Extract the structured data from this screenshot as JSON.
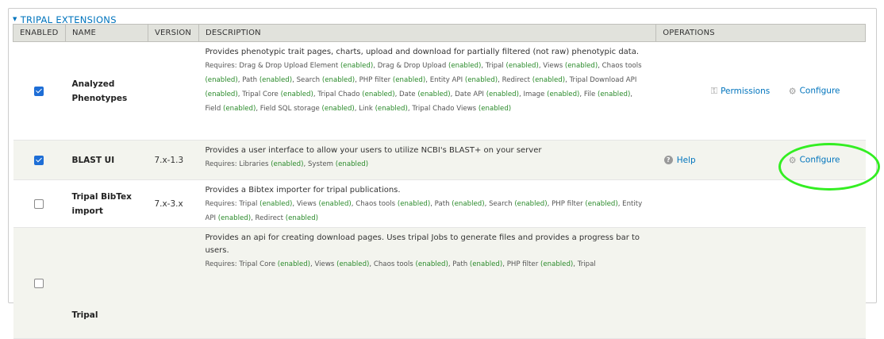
{
  "section": {
    "title": "TRIPAL EXTENSIONS"
  },
  "columns": {
    "enabled": "ENABLED",
    "name": "NAME",
    "version": "VERSION",
    "description": "DESCRIPTION",
    "operations": "OPERATIONS"
  },
  "modules": [
    {
      "enabled": true,
      "name": "Analyzed Phenotypes",
      "version": "",
      "description": "Provides phenotypic trait pages, charts, upload and download for partially filtered (not raw) phenotypic data.",
      "requires_label": "Requires:",
      "enabled_tag": "(enabled)",
      "requires": [
        "Drag & Drop Upload Element",
        "Drag & Drop Upload",
        "Tripal",
        "Views",
        "Chaos tools",
        "Path",
        "Search",
        "PHP filter",
        "Entity API",
        "Redirect",
        "Tripal Download API",
        "Tripal Core",
        "Tripal Chado",
        "Date",
        "Date API",
        "Image",
        "File",
        "Field",
        "Field SQL storage",
        "Link",
        "Tripal Chado Views"
      ],
      "operations": {
        "permissions": "Permissions",
        "configure": "Configure"
      }
    },
    {
      "enabled": true,
      "name": "BLAST UI",
      "version": "7.x-1.3",
      "description": "Provides a user interface to allow your users to utilize NCBI's BLAST+ on your server",
      "requires_label": "Requires:",
      "enabled_tag": "(enabled)",
      "requires": [
        "Libraries",
        "System"
      ],
      "operations": {
        "help": "Help",
        "configure": "Configure"
      }
    },
    {
      "enabled": false,
      "name": "Tripal BibTex import",
      "version": "7.x-3.x",
      "description": "Provides a Bibtex importer for tripal publications.",
      "requires_label": "Requires:",
      "enabled_tag": "(enabled)",
      "requires": [
        "Tripal",
        "Views",
        "Chaos tools",
        "Path",
        "Search",
        "PHP filter",
        "Entity API",
        "Redirect"
      ]
    },
    {
      "enabled": false,
      "name": "Tripal",
      "version": "",
      "description": "Provides an api for creating download pages. Uses tripal Jobs to generate files and provides a progress bar to users.",
      "requires_label": "Requires:",
      "enabled_tag": "(enabled)",
      "requires": [
        "Tripal Core",
        "Views",
        "Chaos tools",
        "Path",
        "PHP filter",
        "Tripal"
      ],
      "requires_truncated": true
    }
  ],
  "annotation": {
    "color": "#33ee22"
  },
  "colors": {
    "link": "#0074bd",
    "enabled_text": "#2a8a2a",
    "header_bg": "#e1e2dc"
  }
}
